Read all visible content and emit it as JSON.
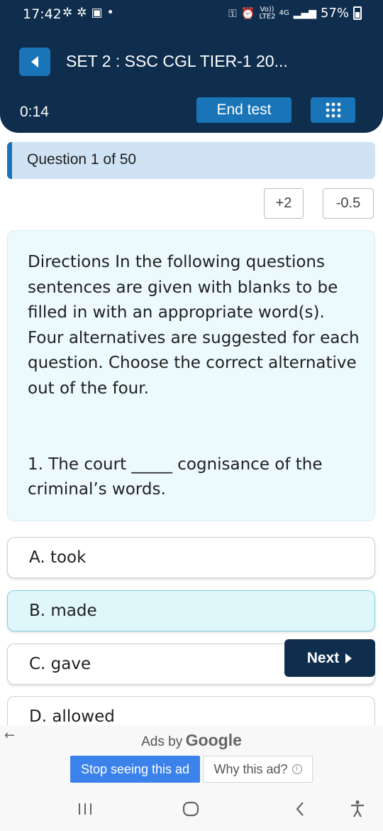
{
  "status_bar": {
    "time": "17:42",
    "left_icons": [
      "sync-icon",
      "sync-icon",
      "voicemail-icon",
      "dot-icon"
    ],
    "right_icons": [
      "key-icon",
      "alarm-icon",
      "volte-icon",
      "4g-icon",
      "signal-icon"
    ],
    "volte_label": "Vo)) LTE2",
    "network_label": "4G",
    "battery": "57%"
  },
  "header": {
    "title": "SET 2 : SSC CGL TIER-1 20...",
    "timer": "0:14",
    "end_test_label": "End test",
    "back_icon": "back-arrow-icon",
    "grid_icon": "grid-icon"
  },
  "question_bar": {
    "label": "Question 1 of 50"
  },
  "marking": {
    "positive": "+2",
    "negative": "-0.5"
  },
  "question": {
    "directions": "Directions  In the following questions sentences are given with blanks to be filled in with an appropriate word(s). Four alternatives are suggested for each question. Choose the correct alternative out of the four.",
    "text": "1. The court _____ cognisance of the criminal’s words."
  },
  "options": [
    {
      "label": "A. took",
      "selected": false
    },
    {
      "label": "B. made",
      "selected": true
    },
    {
      "label": "C. gave",
      "selected": false
    },
    {
      "label": "D. allowed",
      "selected": false
    }
  ],
  "next_label": "Next",
  "ad": {
    "ads_by": "Ads by",
    "brand": "Google",
    "stop_label": "Stop seeing this ad",
    "why_label": "Why this ad?"
  },
  "colors": {
    "header_bg": "#0f2e4e",
    "accent": "#1a74b8",
    "question_bar_bg": "#cfe3f5",
    "card_bg": "#edfafd",
    "selected_bg": "#dff6fa",
    "ad_button": "#3b82ea"
  }
}
